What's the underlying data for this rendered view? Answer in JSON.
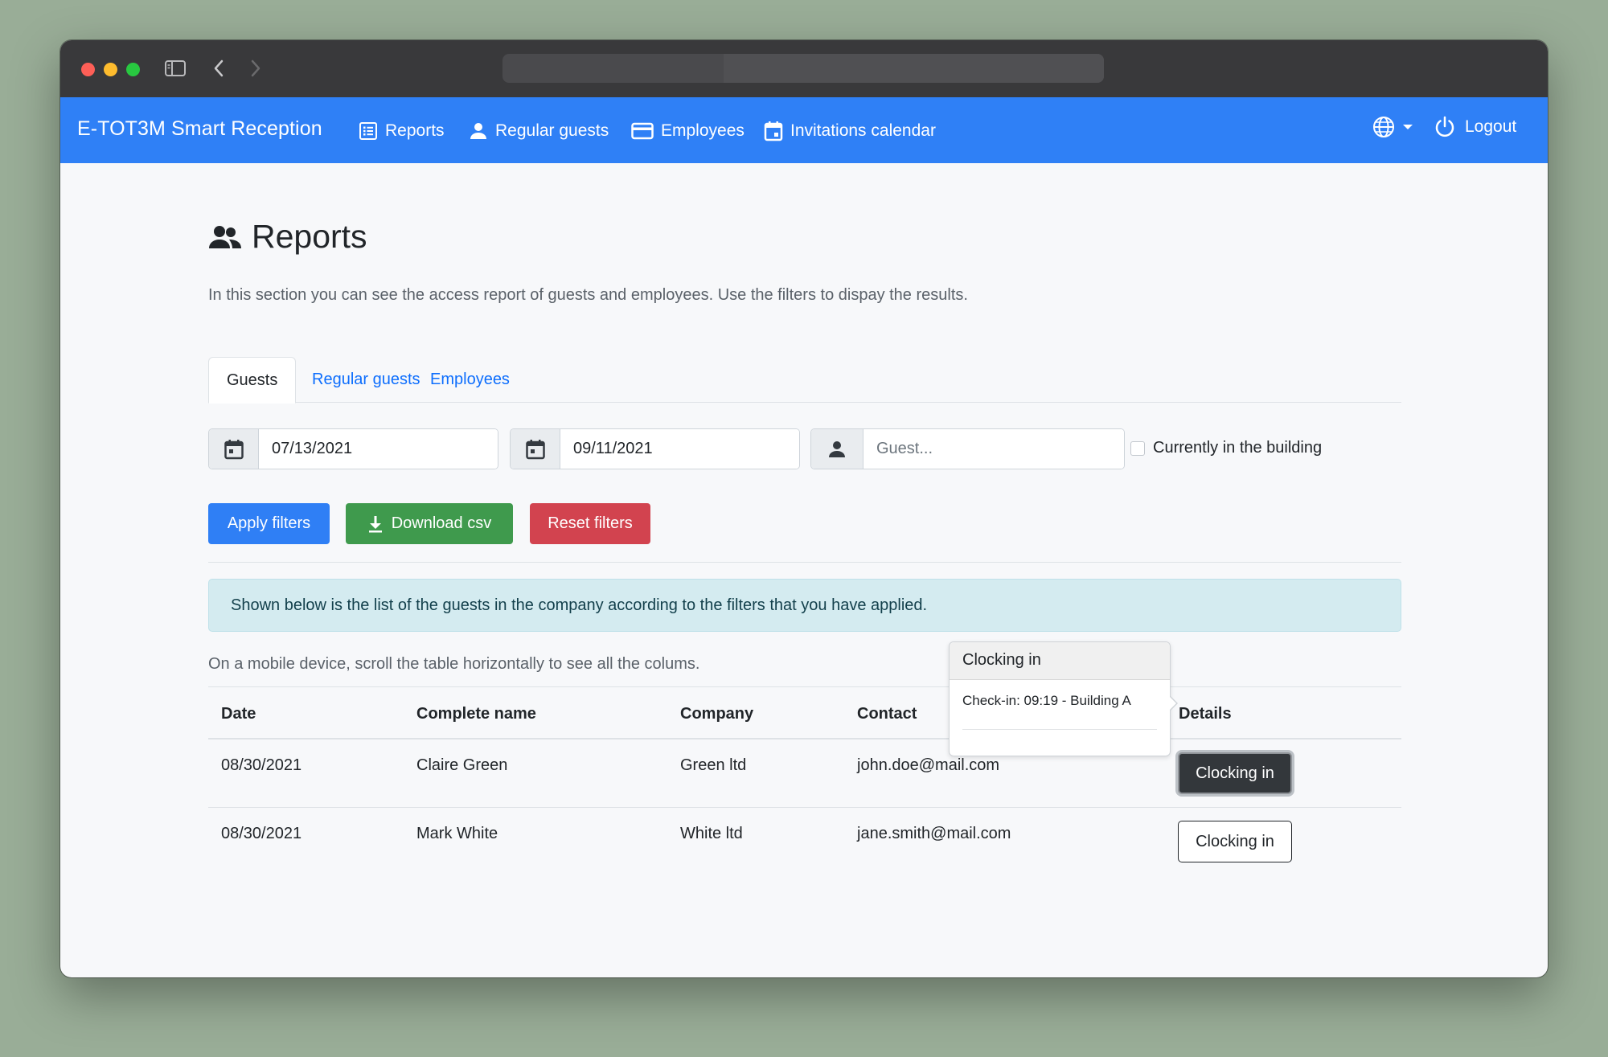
{
  "navbar": {
    "brand": "E-TOT3M Smart Reception",
    "items": [
      {
        "label": "Reports",
        "icon": "list-icon"
      },
      {
        "label": "Regular guests",
        "icon": "person-icon"
      },
      {
        "label": "Employees",
        "icon": "card-icon"
      },
      {
        "label": "Invitations calendar",
        "icon": "calendar-icon"
      }
    ],
    "language_icon": "globe-icon",
    "logout_label": "Logout"
  },
  "page": {
    "title": "Reports",
    "description": "In this section you can see the access report of guests and employees. Use the filters to dispay the results."
  },
  "tabs": [
    {
      "label": "Guests",
      "active": true
    },
    {
      "label": "Regular guests",
      "active": false
    },
    {
      "label": "Employees",
      "active": false
    }
  ],
  "filters": {
    "date_from": "07/13/2021",
    "date_to": "09/11/2021",
    "guest_placeholder": "Guest...",
    "currently_in_building_label": "Currently in the building",
    "currently_in_building_checked": false
  },
  "buttons": {
    "apply": "Apply filters",
    "download": "Download csv",
    "reset": "Reset filters"
  },
  "alert": "Shown below is the list of the guests in the company according to the filters that you have applied.",
  "mobile_note": "On a mobile device, scroll the table horizontally to see all the colums.",
  "table": {
    "headers": [
      "Date",
      "Complete name",
      "Company",
      "Contact",
      "Details"
    ],
    "rows": [
      {
        "date": "08/30/2021",
        "name": "Claire Green",
        "company": "Green ltd",
        "contact": "john.doe@mail.com",
        "details": "Clocking in"
      },
      {
        "date": "08/30/2021",
        "name": "Mark White",
        "company": "White ltd",
        "contact": "jane.smith@mail.com",
        "details": "Clocking in"
      }
    ]
  },
  "popover": {
    "title": "Clocking in",
    "body": "Check-in: 09:19 - Building A"
  },
  "colors": {
    "navbar": "#2f80f6",
    "primary": "#2f7ff5",
    "success": "#3f9a4d",
    "danger": "#d2434f",
    "alert_bg": "#d4ebf0"
  }
}
